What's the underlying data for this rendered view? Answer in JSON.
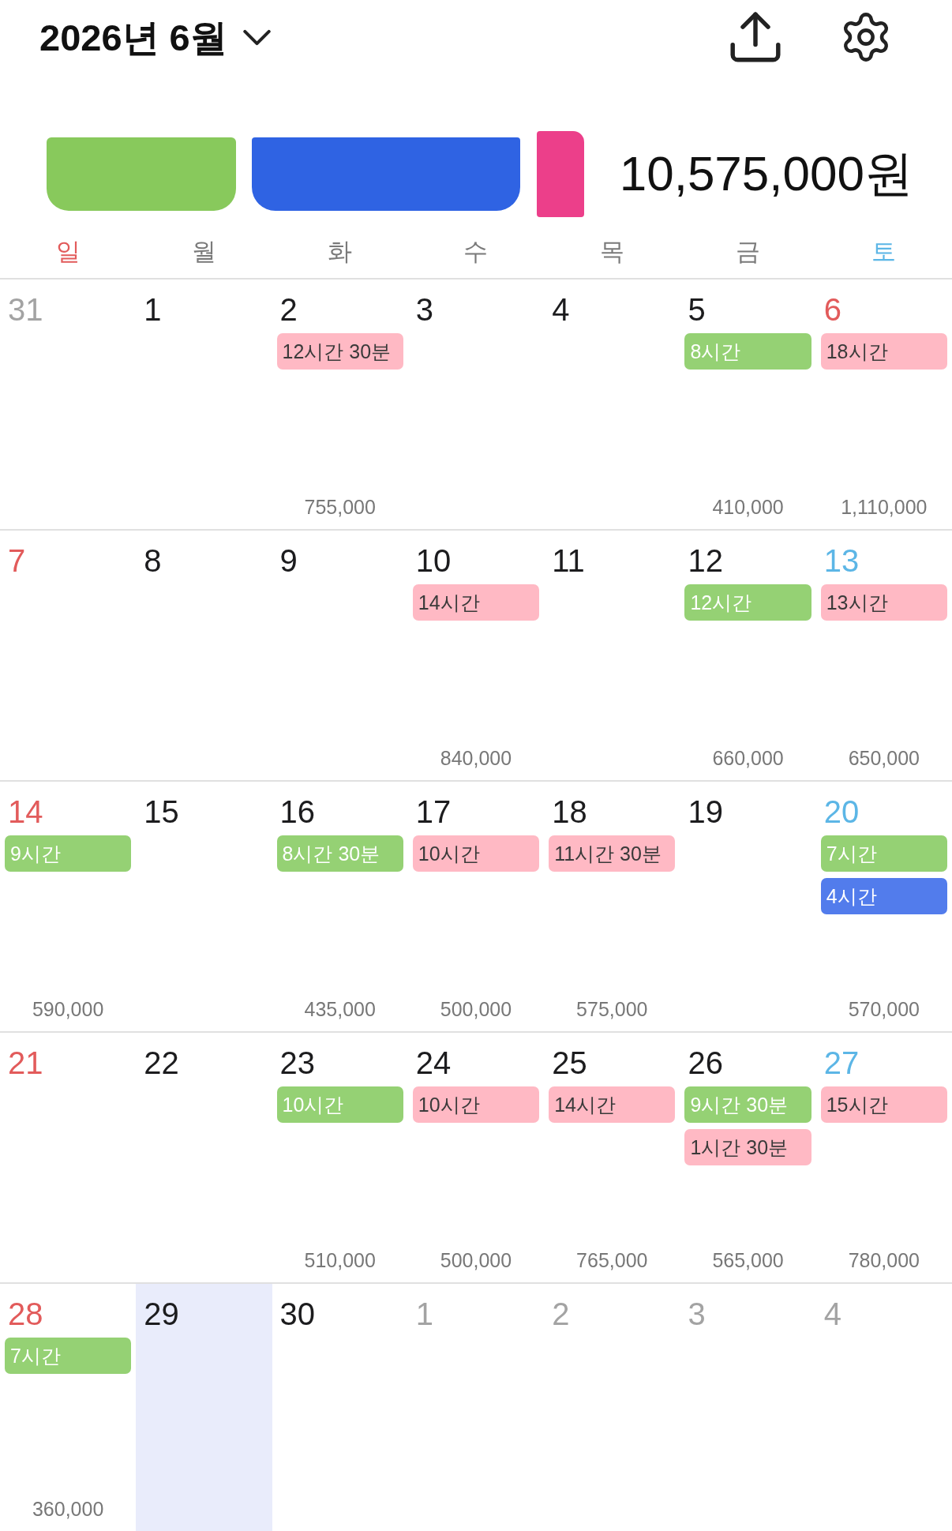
{
  "header": {
    "title": "2026년 6월"
  },
  "summary": {
    "legend": [
      {
        "color": "#88c95c"
      },
      {
        "color": "#2f63e3"
      },
      {
        "color": "#ec3f8a"
      }
    ],
    "total": "10,575,000원"
  },
  "weekdays": [
    {
      "label": "일",
      "kind": "sunday"
    },
    {
      "label": "월",
      "kind": "weekday"
    },
    {
      "label": "화",
      "kind": "weekday"
    },
    {
      "label": "수",
      "kind": "weekday"
    },
    {
      "label": "목",
      "kind": "weekday"
    },
    {
      "label": "금",
      "kind": "weekday"
    },
    {
      "label": "토",
      "kind": "saturday"
    }
  ],
  "weeks": [
    {
      "days": [
        {
          "date": "31",
          "kind": "outside",
          "selected": false
        },
        {
          "date": "1",
          "kind": "weekday",
          "selected": false
        },
        {
          "date": "2",
          "kind": "weekday",
          "selected": false,
          "events": [
            {
              "label": "12시간 30분",
              "color": "#ffb9c4"
            }
          ],
          "amount": "755,000"
        },
        {
          "date": "3",
          "kind": "weekday",
          "selected": false
        },
        {
          "date": "4",
          "kind": "weekday",
          "selected": false
        },
        {
          "date": "5",
          "kind": "weekday",
          "selected": false,
          "events": [
            {
              "label": "8시간",
              "color": "#95d174"
            }
          ],
          "amount": "410,000"
        },
        {
          "date": "6",
          "kind": "holiday",
          "selected": false,
          "events": [
            {
              "label": "18시간",
              "color": "#ffb9c4"
            }
          ],
          "amount": "1,110,000"
        }
      ]
    },
    {
      "days": [
        {
          "date": "7",
          "kind": "sunday",
          "selected": false
        },
        {
          "date": "8",
          "kind": "weekday",
          "selected": false
        },
        {
          "date": "9",
          "kind": "weekday",
          "selected": false
        },
        {
          "date": "10",
          "kind": "weekday",
          "selected": false,
          "events": [
            {
              "label": "14시간",
              "color": "#ffb9c4"
            }
          ],
          "amount": "840,000"
        },
        {
          "date": "11",
          "kind": "weekday",
          "selected": false
        },
        {
          "date": "12",
          "kind": "weekday",
          "selected": false,
          "events": [
            {
              "label": "12시간",
              "color": "#95d174"
            }
          ],
          "amount": "660,000"
        },
        {
          "date": "13",
          "kind": "saturday",
          "selected": false,
          "events": [
            {
              "label": "13시간",
              "color": "#ffb9c4"
            }
          ],
          "amount": "650,000"
        }
      ]
    },
    {
      "days": [
        {
          "date": "14",
          "kind": "sunday",
          "selected": false,
          "events": [
            {
              "label": "9시간",
              "color": "#95d174"
            }
          ],
          "amount": "590,000"
        },
        {
          "date": "15",
          "kind": "weekday",
          "selected": false
        },
        {
          "date": "16",
          "kind": "weekday",
          "selected": false,
          "events": [
            {
              "label": "8시간 30분",
              "color": "#95d174"
            }
          ],
          "amount": "435,000"
        },
        {
          "date": "17",
          "kind": "weekday",
          "selected": false,
          "events": [
            {
              "label": "10시간",
              "color": "#ffb9c4"
            }
          ],
          "amount": "500,000"
        },
        {
          "date": "18",
          "kind": "weekday",
          "selected": false,
          "events": [
            {
              "label": "11시간 30분",
              "color": "#ffb9c4"
            }
          ],
          "amount": "575,000"
        },
        {
          "date": "19",
          "kind": "weekday",
          "selected": false
        },
        {
          "date": "20",
          "kind": "saturday",
          "selected": false,
          "events": [
            {
              "label": "7시간",
              "color": "#95d174"
            },
            {
              "label": "4시간",
              "color": "#527cec"
            }
          ],
          "amount": "570,000"
        }
      ]
    },
    {
      "days": [
        {
          "date": "21",
          "kind": "sunday",
          "selected": false
        },
        {
          "date": "22",
          "kind": "weekday",
          "selected": false
        },
        {
          "date": "23",
          "kind": "weekday",
          "selected": false,
          "events": [
            {
              "label": "10시간",
              "color": "#95d174"
            }
          ],
          "amount": "510,000"
        },
        {
          "date": "24",
          "kind": "weekday",
          "selected": false,
          "events": [
            {
              "label": "10시간",
              "color": "#ffb9c4"
            }
          ],
          "amount": "500,000"
        },
        {
          "date": "25",
          "kind": "weekday",
          "selected": false,
          "events": [
            {
              "label": "14시간",
              "color": "#ffb9c4"
            }
          ],
          "amount": "765,000"
        },
        {
          "date": "26",
          "kind": "weekday",
          "selected": false,
          "events": [
            {
              "label": "9시간 30분",
              "color": "#95d174"
            },
            {
              "label": "1시간 30분",
              "color": "#ffb9c4"
            }
          ],
          "amount": "565,000"
        },
        {
          "date": "27",
          "kind": "saturday",
          "selected": false,
          "events": [
            {
              "label": "15시간",
              "color": "#ffb9c4"
            }
          ],
          "amount": "780,000"
        }
      ]
    },
    {
      "days": [
        {
          "date": "28",
          "kind": "sunday",
          "selected": false,
          "events": [
            {
              "label": "7시간",
              "color": "#95d174"
            }
          ],
          "amount": "360,000"
        },
        {
          "date": "29",
          "kind": "weekday",
          "selected": true
        },
        {
          "date": "30",
          "kind": "weekday",
          "selected": false
        },
        {
          "date": "1",
          "kind": "outside",
          "selected": false
        },
        {
          "date": "2",
          "kind": "outside",
          "selected": false
        },
        {
          "date": "3",
          "kind": "outside",
          "selected": false
        },
        {
          "date": "4",
          "kind": "outside",
          "selected": false
        }
      ]
    }
  ]
}
